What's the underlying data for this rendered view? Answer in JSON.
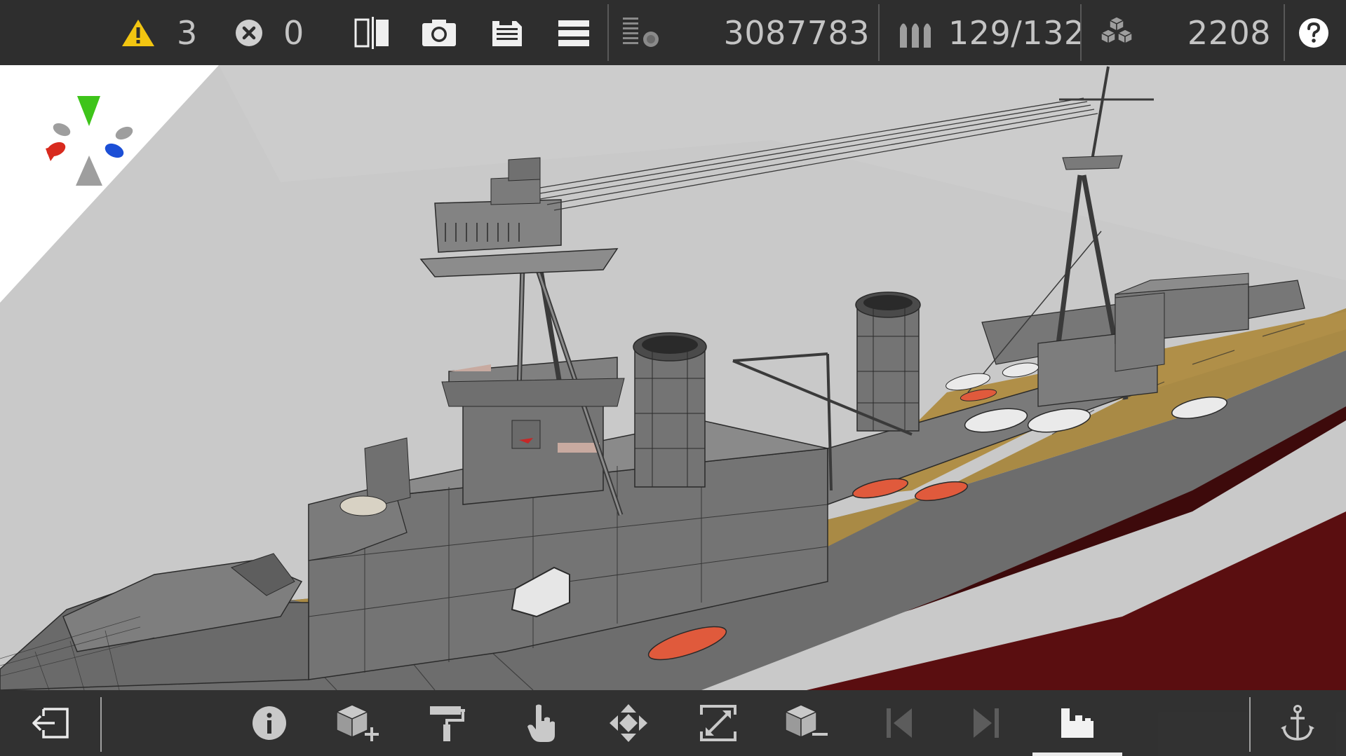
{
  "topbar": {
    "warnings": "3",
    "errors": "0",
    "vertex_count": "3087783",
    "ammo": "129/132",
    "parts": "2208"
  },
  "colors": {
    "toolbar_bg": "#2e2e2e",
    "warning_yellow": "#f2c511",
    "hull_gray": "#6e6e6e",
    "deck_tan": "#a98a45",
    "waterline_red": "#5a0e10",
    "boat_red": "#e05a3c",
    "axis_green": "#3ec41a",
    "axis_red": "#d82a1e",
    "axis_blue": "#1c4fd6"
  },
  "icons": {
    "top": [
      "warning-icon",
      "error-icon",
      "mirror-icon",
      "camera-icon",
      "save-icon",
      "menu-icon",
      "render-stats-icon",
      "shells-icon",
      "blocks-icon",
      "help-icon"
    ],
    "bottom": [
      "exit-icon",
      "info-icon",
      "add-block-icon",
      "paint-roller-icon",
      "hand-pointer-icon",
      "move-icon",
      "resize-icon",
      "remove-block-icon",
      "previous-icon",
      "next-icon",
      "build-mode-icon",
      "anchor-icon"
    ]
  }
}
